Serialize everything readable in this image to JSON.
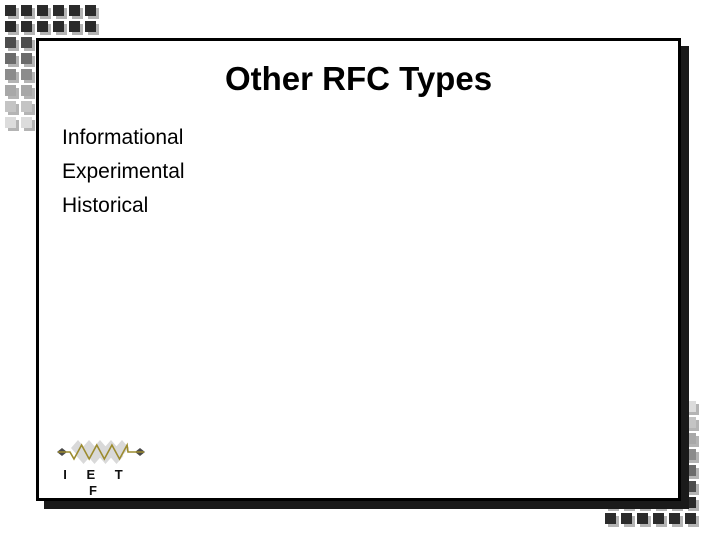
{
  "slide": {
    "title": "Other RFC Types",
    "bullets": [
      {
        "text": "Informational"
      },
      {
        "text": "Experimental"
      },
      {
        "text": "Historical"
      }
    ]
  },
  "logo": {
    "name": "ietf-logo",
    "text": "IETF",
    "art_colors": {
      "diamond": "#d9d9d9",
      "wave": "#9c8b2e",
      "cap": "#4a4a4a"
    }
  },
  "decoration": {
    "square_size_px": 11,
    "shadow_color": "#b4b4b4",
    "top_left": {
      "header_rows": 2,
      "header_cols": 6,
      "column_rows": 8,
      "gradient": [
        "#2b2b2b",
        "#2b2b2b",
        "#4d4d4d",
        "#6b6b6b",
        "#8c8c8c",
        "#a8a8a8",
        "#c4c4c4",
        "#dcdcdc"
      ]
    },
    "bottom_right": {
      "footer_rows": 2,
      "footer_cols": 6,
      "column_rows": 8,
      "gradient": [
        "#dcdcdc",
        "#c4c4c4",
        "#a8a8a8",
        "#8c8c8c",
        "#6b6b6b",
        "#4d4d4d",
        "#2b2b2b",
        "#2b2b2b"
      ]
    }
  },
  "frame": {
    "border_color": "#000000",
    "shadow_color": "#1a1a1a",
    "background": "#ffffff"
  }
}
